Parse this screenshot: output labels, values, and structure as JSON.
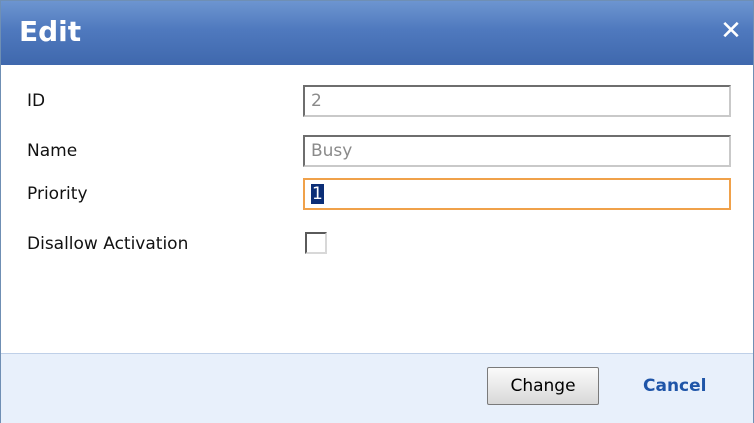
{
  "dialog": {
    "title": "Edit",
    "close_glyph": "✕"
  },
  "form": {
    "id": {
      "label": "ID",
      "value": "2"
    },
    "name": {
      "label": "Name",
      "value": "Busy"
    },
    "priority": {
      "label": "Priority",
      "value": "1"
    },
    "disallow_activation": {
      "label": "Disallow Activation",
      "checked": false
    }
  },
  "footer": {
    "change_label": "Change",
    "cancel_label": "Cancel"
  },
  "colors": {
    "titlebar": "#4f79be",
    "focus_border": "#f0a14a",
    "footer_bg": "#e8f0fb",
    "link": "#1f55a8"
  }
}
